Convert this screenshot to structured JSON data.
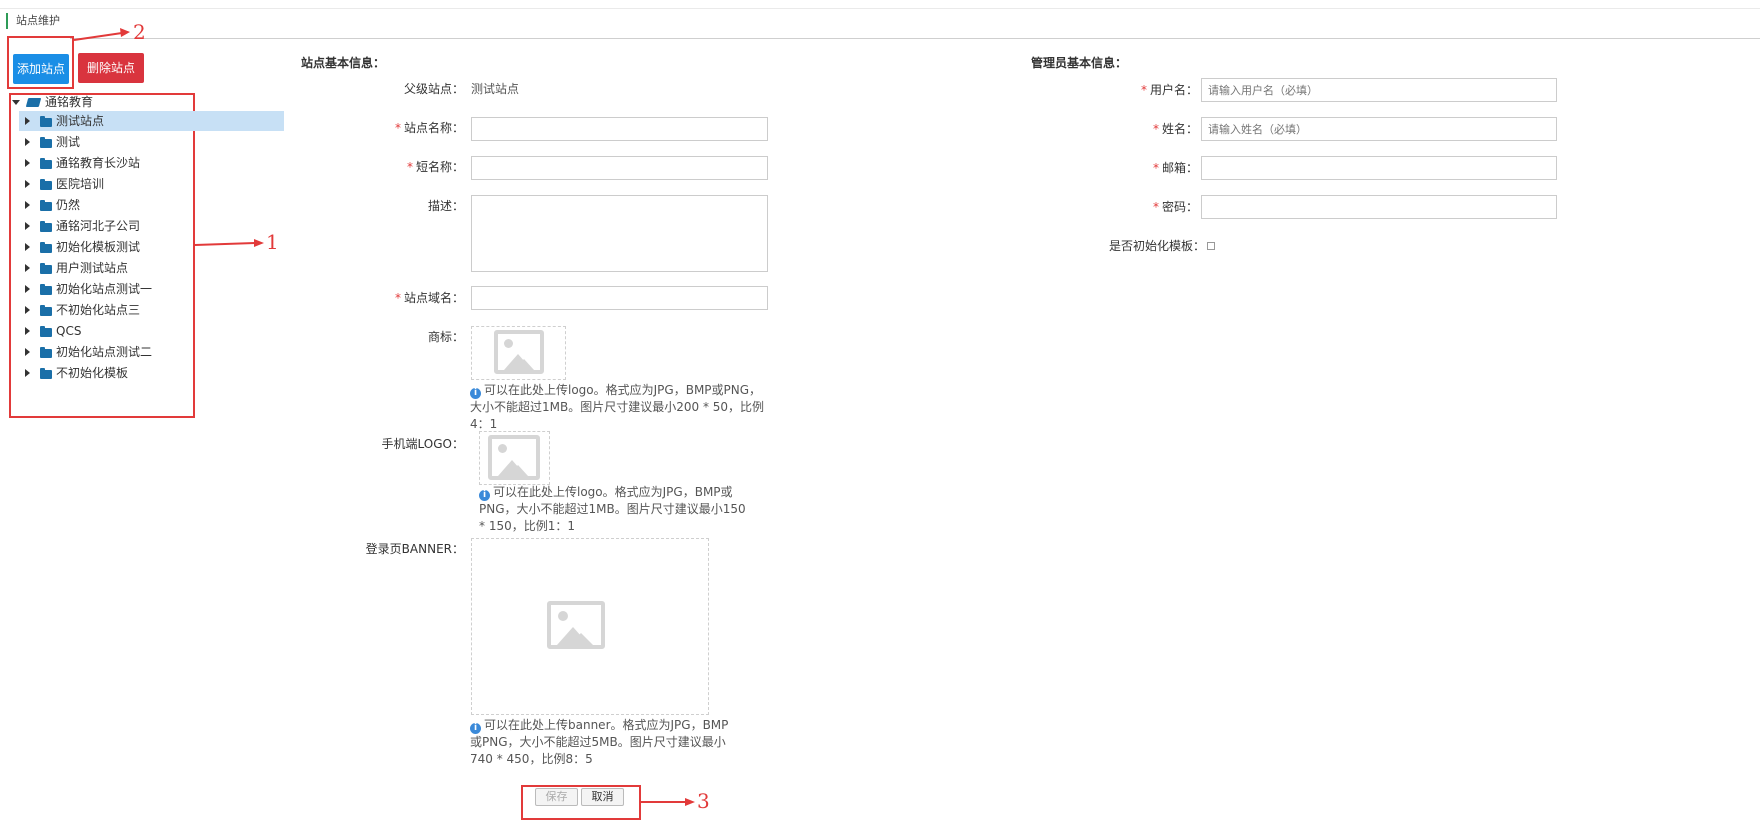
{
  "page_title": "站点维护",
  "toolbar": {
    "add_label": "添加站点",
    "delete_label": "删除站点"
  },
  "annotations": [
    "1",
    "2",
    "3"
  ],
  "tree": {
    "root": "通铭教育",
    "children": [
      "测试站点",
      "测试",
      "通铭教育长沙站",
      "医院培训",
      "仍然",
      "通铭河北子公司",
      "初始化模板测试",
      "用户测试站点",
      "初始化站点测试一",
      "不初始化站点三",
      "QCS",
      "初始化站点测试二",
      "不初始化模板"
    ],
    "selected": "测试站点"
  },
  "site_info": {
    "section_title": "站点基本信息：",
    "parent_label": "父级站点：",
    "parent_value": "测试站点",
    "name_label": "站点名称：",
    "short_name_label": "短名称：",
    "desc_label": "描述：",
    "domain_label": "站点域名：",
    "logo_label": "商标：",
    "logo_hint": "可以在此处上传logo。格式应为JPG，BMP或PNG，大小不能超过1MB。图片尺寸建议最小200 * 50，比例4：1",
    "mobile_logo_label": "手机端LOGO：",
    "mobile_logo_hint": "可以在此处上传logo。格式应为JPG，BMP或PNG，大小不能超过1MB。图片尺寸建议最小150 * 150，比例1：1",
    "banner_label": "登录页BANNER：",
    "banner_hint": "可以在此处上传banner。格式应为JPG，BMP或PNG，大小不能超过5MB。图片尺寸建议最小740 * 450，比例8：5",
    "save_label": "保存",
    "cancel_label": "取消"
  },
  "admin_info": {
    "section_title": "管理员基本信息：",
    "username_label": "用户名：",
    "username_placeholder": "请输入用户名（必填）",
    "realname_label": "姓名：",
    "realname_placeholder": "请输入姓名（必填）",
    "email_label": "邮箱：",
    "password_label": "密码：",
    "init_template_label": "是否初始化模板："
  },
  "colors": {
    "primary": "#1a8ee6",
    "danger": "#d9343e",
    "annotation": "#e23a3a",
    "selected_row": "#c7e0f5",
    "folder": "#1a6fa8"
  }
}
